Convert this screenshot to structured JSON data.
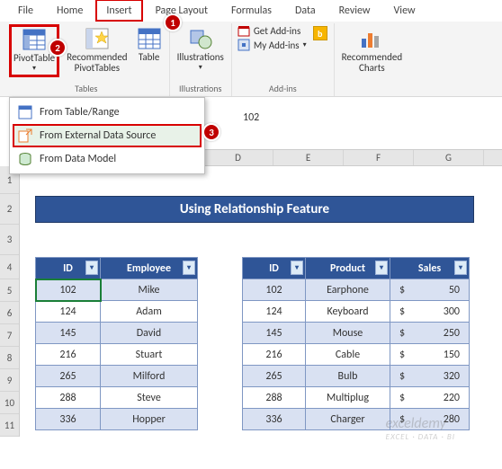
{
  "tabs": [
    "File",
    "Home",
    "Insert",
    "Page Layout",
    "Formulas",
    "Data",
    "Review",
    "View"
  ],
  "highlight_tab_index": 2,
  "ribbon": {
    "pivottable": "PivotTable",
    "recommended_pivottables": "Recommended\nPivotTables",
    "table": "Table",
    "tables_group": "Tables",
    "illustrations": "Illustrations",
    "illustrations_group": "Illustrations",
    "get_addins": "Get Add-ins",
    "my_addins": "My Add-ins",
    "addins_group": "Add-ins",
    "recommended_charts": "Recommended\nCharts"
  },
  "dropdown": {
    "from_table_range": "From Table/Range",
    "from_external": "From External Data Source",
    "from_data_model": "From Data Model"
  },
  "formula_bar_value": "102",
  "columns": [
    "D",
    "E",
    "F",
    "G"
  ],
  "rows": [
    1,
    2,
    3,
    4,
    5,
    6,
    7,
    8,
    9,
    10,
    11
  ],
  "title": "Using Relationship Feature",
  "table1": {
    "headers": [
      "ID",
      "Employee"
    ],
    "rows": [
      [
        "102",
        "Mike"
      ],
      [
        "124",
        "Adam"
      ],
      [
        "145",
        "David"
      ],
      [
        "216",
        "Stuart"
      ],
      [
        "265",
        "Milford"
      ],
      [
        "288",
        "Steve"
      ],
      [
        "336",
        "Hopper"
      ]
    ]
  },
  "table2": {
    "headers": [
      "ID",
      "Product",
      "Sales"
    ],
    "rows": [
      [
        "102",
        "Earphone",
        "50"
      ],
      [
        "124",
        "Keyboard",
        "300"
      ],
      [
        "145",
        "Mouse",
        "250"
      ],
      [
        "216",
        "Cable",
        "150"
      ],
      [
        "265",
        "Bulb",
        "320"
      ],
      [
        "288",
        "Multiplug",
        "220"
      ],
      [
        "336",
        "Charger",
        "280"
      ]
    ],
    "currency": "$"
  },
  "badges": {
    "b1": "1",
    "b2": "2",
    "b3": "3"
  },
  "watermark": {
    "line1": "exceldemy",
    "line2": "EXCEL · DATA · BI"
  }
}
